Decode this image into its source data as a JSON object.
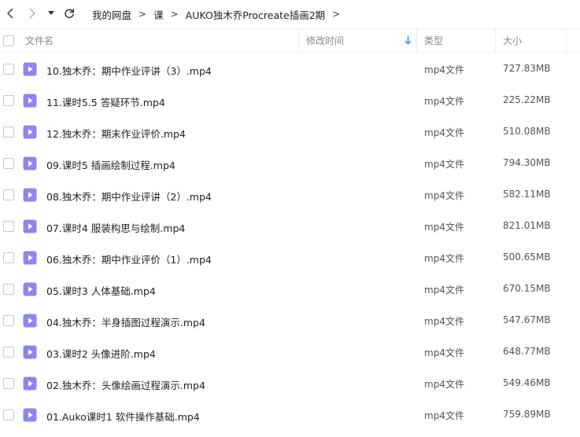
{
  "nav": {
    "back_icon": "chevron-left-icon",
    "forward_icon": "chevron-right-icon",
    "history_icon": "caret-down-icon",
    "refresh_icon": "refresh-icon"
  },
  "breadcrumb": [
    "我的网盘",
    "课",
    "AUKO独木乔Procreate插画2期"
  ],
  "breadcrumb_sep": ">",
  "columns": {
    "name": "文件名",
    "modified": "修改时间",
    "type": "类型",
    "size": "大小"
  },
  "sort": {
    "column": "modified",
    "direction": "desc"
  },
  "colors": {
    "icon_purple": "#8f85ea",
    "sort_blue": "#2f8cf0"
  },
  "files": [
    {
      "name": "10.独木乔：期中作业评讲（3）.mp4",
      "type": "mp4文件",
      "size": "727.83MB"
    },
    {
      "name": "11.课时5.5 答疑环节.mp4",
      "type": "mp4文件",
      "size": "225.22MB"
    },
    {
      "name": "12.独木乔：期末作业评价.mp4",
      "type": "mp4文件",
      "size": "510.08MB"
    },
    {
      "name": "09.课时5 插画绘制过程.mp4",
      "type": "mp4文件",
      "size": "794.30MB"
    },
    {
      "name": "08.独木乔：期中作业评讲（2）.mp4",
      "type": "mp4文件",
      "size": "582.11MB"
    },
    {
      "name": "07.课时4 服装构思与绘制.mp4",
      "type": "mp4文件",
      "size": "821.01MB"
    },
    {
      "name": "06.独木乔：期中作业评价（1）.mp4",
      "type": "mp4文件",
      "size": "500.65MB"
    },
    {
      "name": "05.课时3 人体基础.mp4",
      "type": "mp4文件",
      "size": "670.15MB"
    },
    {
      "name": "04.独木乔：半身插图过程演示.mp4",
      "type": "mp4文件",
      "size": "547.67MB"
    },
    {
      "name": "03.课时2 头像进阶.mp4",
      "type": "mp4文件",
      "size": "648.77MB"
    },
    {
      "name": "02.独木乔：头像绘画过程演示.mp4",
      "type": "mp4文件",
      "size": "549.46MB"
    },
    {
      "name": "01.Auko课时1 软件操作基础.mp4",
      "type": "mp4文件",
      "size": "759.89MB"
    }
  ]
}
